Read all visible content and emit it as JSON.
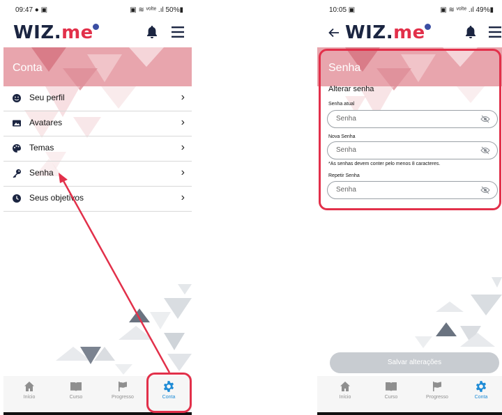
{
  "left": {
    "status": {
      "time": "09:47 ● ▣",
      "right": "▣ ≋ ᵛᵒˡᵗᵉ .ıl 50%▮"
    },
    "logo": {
      "wiz": "WIZ.",
      "me": "me"
    },
    "section_title": "Conta",
    "menu": [
      {
        "label": "Seu perfil",
        "icon": "smiley-icon"
      },
      {
        "label": "Avatares",
        "icon": "image-icon"
      },
      {
        "label": "Temas",
        "icon": "palette-icon"
      },
      {
        "label": "Senha",
        "icon": "key-icon"
      },
      {
        "label": "Seus objetivos",
        "icon": "clock-icon"
      }
    ],
    "nav": [
      {
        "label": "Início",
        "icon": "home-icon"
      },
      {
        "label": "Curso",
        "icon": "book-icon"
      },
      {
        "label": "Progresso",
        "icon": "flag-icon"
      },
      {
        "label": "Conta",
        "icon": "gear-icon"
      }
    ]
  },
  "right": {
    "status": {
      "time": "10:05 ▣",
      "right": "▣ ≋ ᵛᵒˡᵗᵉ .ıl 49%▮"
    },
    "logo": {
      "wiz": "WIZ.",
      "me": "me"
    },
    "section_title": "Senha",
    "subtitle": "Alterar senha",
    "fields": [
      {
        "label": "Senha atual",
        "placeholder": "Senha"
      },
      {
        "label": "Nova Senha",
        "placeholder": "Senha"
      },
      {
        "label": "Repetir Senha",
        "placeholder": "Senha"
      }
    ],
    "hint": "*As senhas devem conter pelo menos 8 caracteres.",
    "save_label": "Salvar alterações",
    "nav": [
      {
        "label": "Início",
        "icon": "home-icon"
      },
      {
        "label": "Curso",
        "icon": "book-icon"
      },
      {
        "label": "Progresso",
        "icon": "flag-icon"
      },
      {
        "label": "Conta",
        "icon": "gear-icon"
      }
    ]
  },
  "colors": {
    "brand_red": "#e2304a",
    "active_blue": "#1e8bd6",
    "navy": "#1b2541",
    "header_pink": "#e7a3ab"
  }
}
